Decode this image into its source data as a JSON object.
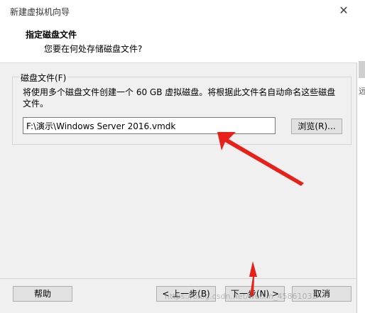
{
  "window": {
    "title": "新建虚拟机向导",
    "close_glyph": "✕"
  },
  "header": {
    "title": "指定磁盘文件",
    "subtitle": "您要在何处存储磁盘文件?"
  },
  "disk_group": {
    "label": "磁盘文件(F)",
    "description": "将使用多个磁盘文件创建一个 60 GB 虚拟磁盘。将根据此文件名自动命名这些磁盘文件。",
    "path_value": "F:\\演示\\Windows Server 2016.vmdk",
    "browse_label": "浏览(R)..."
  },
  "footer": {
    "help_label": "帮助",
    "back_label": "< 上一步(B)",
    "next_label": "下一步(N) >",
    "cancel_label": "取消"
  },
  "side": {
    "glyph": "远"
  },
  "watermark": "https://blog.csdn.net/weixin_45861032",
  "annotation_color": "#e8201a"
}
